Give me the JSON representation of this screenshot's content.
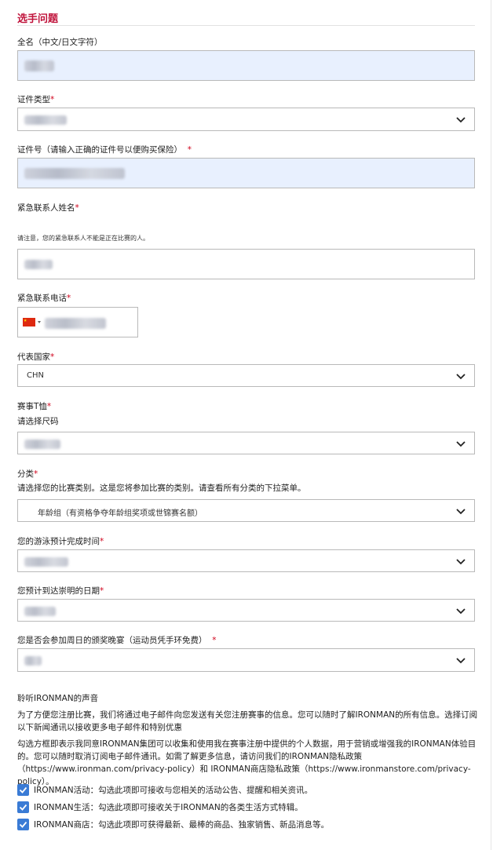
{
  "section": {
    "title": "选手问题"
  },
  "fields": {
    "full_name": {
      "label": "全名（中文/日文字符）"
    },
    "id_type": {
      "label": "证件类型",
      "required": "*"
    },
    "id_number": {
      "label": "证件号（请输入正确的证件号以便购买保险）",
      "required": "*"
    },
    "emergency_name": {
      "label": "紧急联系人姓名",
      "required": "*",
      "note": "请注意，您的紧急联系人不能是正在比赛的人。"
    },
    "emergency_phone": {
      "label": "紧急联系电话",
      "required": "*",
      "flag": "china-flag-icon"
    },
    "country": {
      "label": "代表国家",
      "required": "*",
      "value": "CHN"
    },
    "tshirt": {
      "label": "赛事T恤",
      "required": "*",
      "help": "请选择尺码"
    },
    "category": {
      "label": "分类",
      "required": "*",
      "help": "请选择您的比赛类别。这是您将参加比赛的类别。请查看所有分类的下拉菜单。",
      "value": "年龄组（有资格争夺年龄组奖项或世锦赛名额）"
    },
    "swim_time": {
      "label": "您的游泳预计完成时间",
      "required": "*"
    },
    "arrival_date": {
      "label": "您预计到达崇明的日期",
      "required": "*"
    },
    "banquet": {
      "label": "您是否会参加周日的颁奖晚宴（运动员凭手环免费）",
      "required": "*"
    }
  },
  "ironman_voice": {
    "title": "聆听IRONMAN的声音",
    "para1_line1": "为了方便您注册比赛，我们将通过电子邮件向您发送有关您注册赛事的信息。您可以随时了解IRONMAN的所有信息。选择订阅",
    "para1_line2": "以下新闻通讯以接收更多电子邮件和特别优惠",
    "para2_line1": "勾选方框即表示我同意IRONMAN集团可以收集和使用我在赛事注册中提供的个人数据，用于营销或增强我的IRONMAN体验目",
    "para2_line2": "的。您可以随时取消订阅电子邮件通讯。如需了解更多信息，请访问我们的IRONMAN隐私政策",
    "para2_line3": "（https://www.ironman.com/privacy-policy）和 IRONMAN商店隐私政策（https://www.ironmanstore.com/privacy-policy）。",
    "checkboxes": [
      {
        "label": "IRONMAN活动：勾选此项即可接收与您相关的活动公告、提醒和相关资讯。",
        "checked": true
      },
      {
        "label": "IRONMAN生活：勾选此项即可接收关于IRONMAN的各类生活方式特辑。",
        "checked": true
      },
      {
        "label": "IRONMAN商店：勾选此项即可获得最新、最棒的商品、独家销售、新品消息等。",
        "checked": true
      }
    ]
  },
  "colors": {
    "title": "#c0143c",
    "required": "#d0021b",
    "filled_bg": "#e8f0fe",
    "checkbox": "#3a7bd5"
  }
}
